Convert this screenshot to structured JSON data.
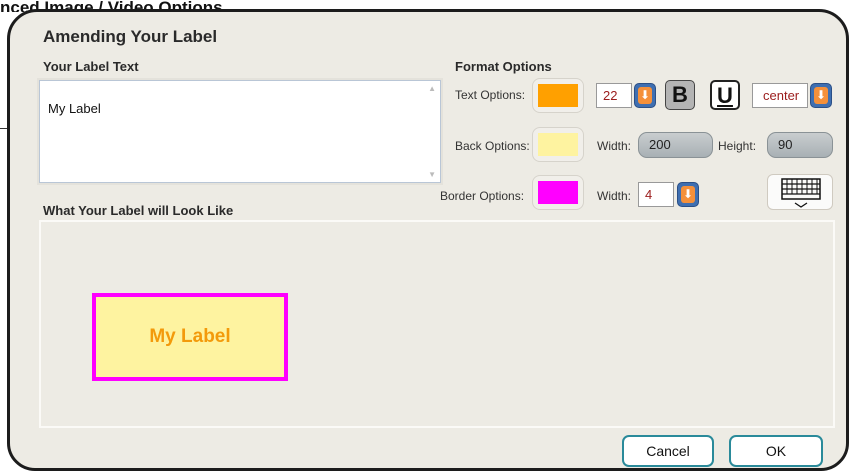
{
  "background": {
    "title": "nced Image / Video Options"
  },
  "dialog": {
    "title": "Amending Your Label",
    "label_text_section": "Your Label Text",
    "label_text_value": "My Label",
    "format_section": "Format Options",
    "preview_section": "What Your Label will Look Like"
  },
  "text_options": {
    "label": "Text Options:",
    "color": "#ffa000",
    "font_size": "22",
    "bold": "B",
    "underline": "U",
    "align": "center"
  },
  "back_options": {
    "label": "Back Options:",
    "color": "#fef3a0",
    "width_label": "Width:",
    "width": "200",
    "height_label": "Height:",
    "height": "90"
  },
  "border_options": {
    "label": "Border Options:",
    "color": "#ff00ff",
    "width_label": "Width:",
    "width": "4"
  },
  "preview": {
    "text": "My Label"
  },
  "buttons": {
    "cancel": "Cancel",
    "ok": "OK"
  }
}
